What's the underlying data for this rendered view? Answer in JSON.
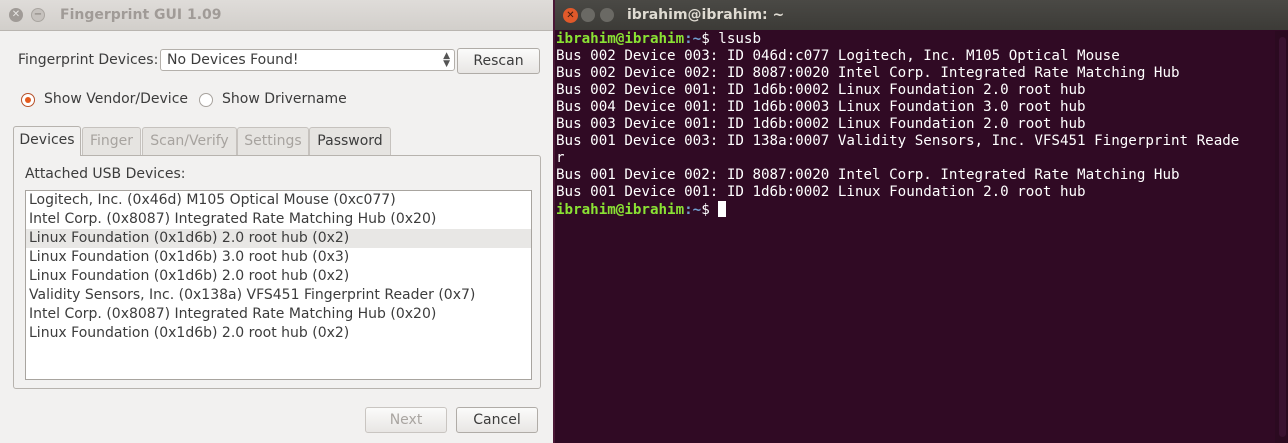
{
  "gui_window": {
    "title": "Fingerprint GUI 1.09",
    "close_glyph": "✕",
    "minimize_glyph": "−",
    "devices_label": "Fingerprint Devices:",
    "device_combo_value": "No Devices Found!",
    "rescan_label": "Rescan",
    "radio_vendor_label": "Show Vendor/Device",
    "radio_driver_label": "Show Drivername",
    "radio_selected": "Show Vendor/Device",
    "tabs": [
      {
        "label": "Devices",
        "active": true
      },
      {
        "label": "Finger",
        "active": false
      },
      {
        "label": "Scan/Verify",
        "active": false
      },
      {
        "label": "Settings",
        "active": false
      },
      {
        "label": "Password",
        "active": false
      }
    ],
    "usb_label": "Attached USB Devices:",
    "usb_devices": [
      "Logitech, Inc. (0x46d) M105 Optical Mouse (0xc077)",
      "Intel Corp. (0x8087) Integrated Rate Matching Hub (0x20)",
      "Linux Foundation (0x1d6b) 2.0 root hub (0x2)",
      "Linux Foundation (0x1d6b) 3.0 root hub (0x3)",
      "Linux Foundation (0x1d6b) 2.0 root hub (0x2)",
      "Validity Sensors, Inc. (0x138a) VFS451 Fingerprint Reader (0x7)",
      "Intel Corp. (0x8087) Integrated Rate Matching Hub (0x20)",
      "Linux Foundation (0x1d6b) 2.0 root hub (0x2)"
    ],
    "usb_selected_index": 2,
    "next_label": "Next",
    "cancel_label": "Cancel"
  },
  "terminal": {
    "title": "ibrahim@ibrahim: ~",
    "close_glyph": "✕",
    "prompt_user": "ibrahim@ibrahim",
    "prompt_path": ":~",
    "command_line": "$ lsusb",
    "final_prompt": "$ ",
    "output": [
      "Bus 002 Device 003: ID 046d:c077 Logitech, Inc. M105 Optical Mouse",
      "Bus 002 Device 002: ID 8087:0020 Intel Corp. Integrated Rate Matching Hub",
      "Bus 002 Device 001: ID 1d6b:0002 Linux Foundation 2.0 root hub",
      "Bus 004 Device 001: ID 1d6b:0003 Linux Foundation 3.0 root hub",
      "Bus 003 Device 001: ID 1d6b:0002 Linux Foundation 2.0 root hub",
      "Bus 001 Device 003: ID 138a:0007 Validity Sensors, Inc. VFS451 Fingerprint Reade",
      "r",
      "Bus 001 Device 002: ID 8087:0020 Intel Corp. Integrated Rate Matching Hub",
      "Bus 001 Device 001: ID 1d6b:0002 Linux Foundation 2.0 root hub"
    ]
  },
  "colors": {
    "terminal_bg": "#300a24",
    "prompt_user": "#8ae234",
    "prompt_path": "#729fcf",
    "radio_accent": "#e55a1c"
  }
}
